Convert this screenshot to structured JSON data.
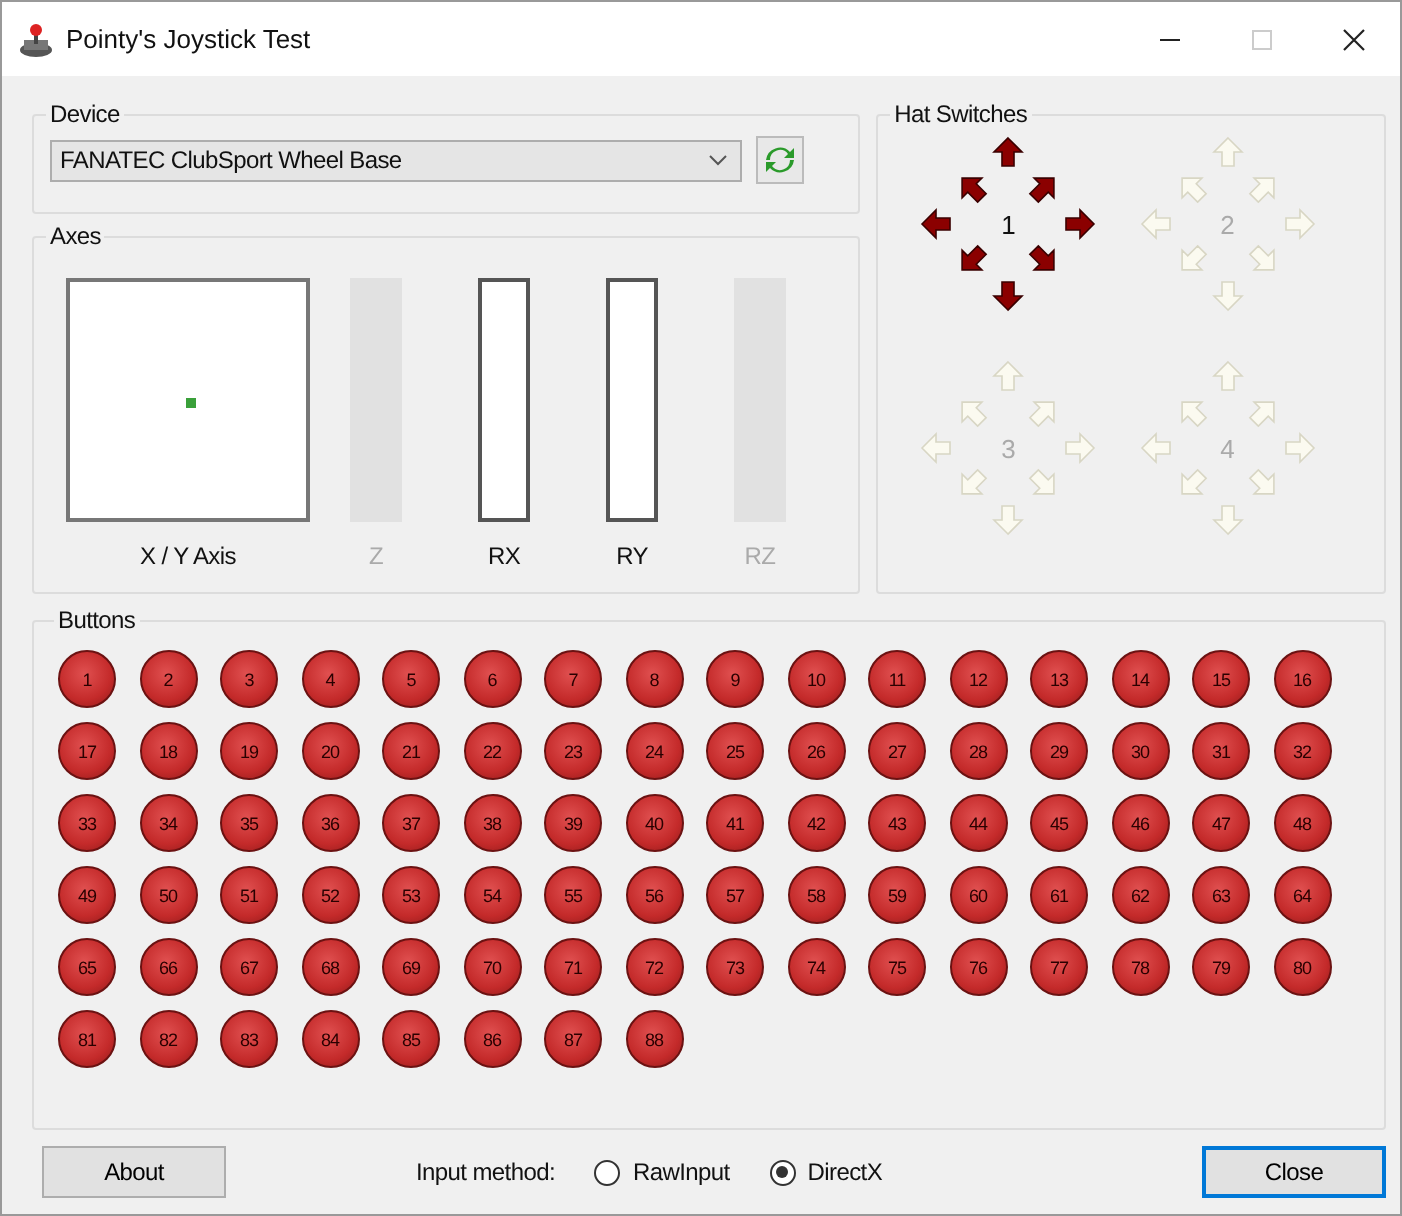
{
  "window": {
    "title": "Pointy's Joystick Test",
    "maximize_disabled": true
  },
  "device": {
    "label": "Device",
    "value": "FANATEC ClubSport Wheel Base"
  },
  "axes": {
    "label": "Axes",
    "xy_label": "X / Y Axis",
    "sliders": [
      {
        "label": "Z",
        "disabled": true
      },
      {
        "label": "RX",
        "disabled": false
      },
      {
        "label": "RY",
        "disabled": false
      },
      {
        "label": "RZ",
        "disabled": true
      }
    ]
  },
  "hat_switches": {
    "label": "Hat Switches",
    "hats": [
      {
        "label": "1",
        "disabled": false
      },
      {
        "label": "2",
        "disabled": true
      },
      {
        "label": "3",
        "disabled": true
      },
      {
        "label": "4",
        "disabled": true
      }
    ]
  },
  "buttons": {
    "label": "Buttons",
    "items": [
      "1",
      "2",
      "3",
      "4",
      "5",
      "6",
      "7",
      "8",
      "9",
      "10",
      "11",
      "12",
      "13",
      "14",
      "15",
      "16",
      "17",
      "18",
      "19",
      "20",
      "21",
      "22",
      "23",
      "24",
      "25",
      "26",
      "27",
      "28",
      "29",
      "30",
      "31",
      "32",
      "33",
      "34",
      "35",
      "36",
      "37",
      "38",
      "39",
      "40",
      "41",
      "42",
      "43",
      "44",
      "45",
      "46",
      "47",
      "48",
      "49",
      "50",
      "51",
      "52",
      "53",
      "54",
      "55",
      "56",
      "57",
      "58",
      "59",
      "60",
      "61",
      "62",
      "63",
      "64",
      "65",
      "66",
      "67",
      "68",
      "69",
      "70",
      "71",
      "72",
      "73",
      "74",
      "75",
      "76",
      "77",
      "78",
      "79",
      "80",
      "81",
      "82",
      "83",
      "84",
      "85",
      "86",
      "87",
      "88"
    ]
  },
  "footer": {
    "about": "About",
    "input_method_label": "Input method:",
    "options": [
      {
        "label": "RawInput",
        "selected": false
      },
      {
        "label": "DirectX",
        "selected": true
      }
    ],
    "close": "Close"
  }
}
